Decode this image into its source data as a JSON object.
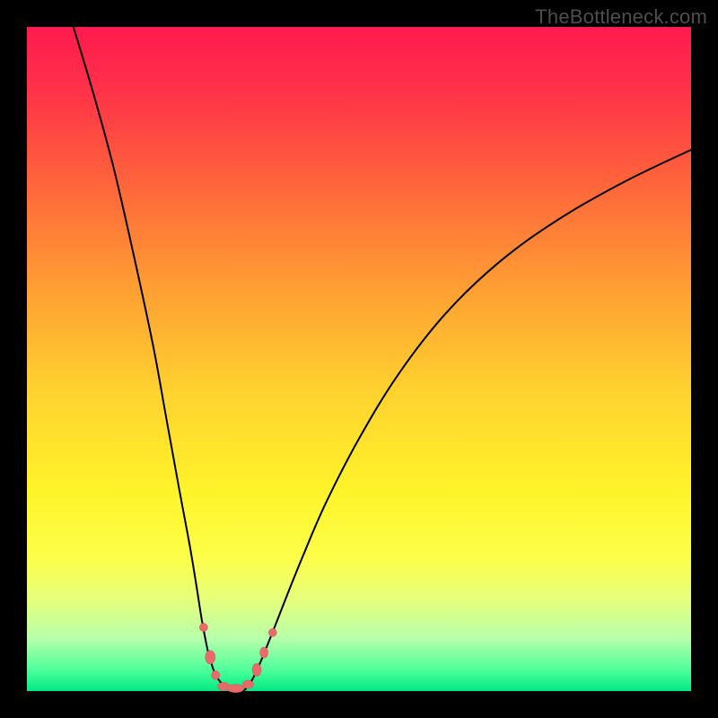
{
  "watermark": "TheBottleneck.com",
  "colors": {
    "frame": "#000000",
    "watermark": "#4e4e4e",
    "curve": "#000000",
    "marker_fill": "#e86a6a",
    "marker_stroke": "#d85a5a",
    "gradient_stops": [
      {
        "offset": 0.0,
        "color": "#ff1a4f"
      },
      {
        "offset": 0.1,
        "color": "#ff3348"
      },
      {
        "offset": 0.25,
        "color": "#ff6a3a"
      },
      {
        "offset": 0.4,
        "color": "#ffa133"
      },
      {
        "offset": 0.55,
        "color": "#ffd22f"
      },
      {
        "offset": 0.7,
        "color": "#fff42a"
      },
      {
        "offset": 0.8,
        "color": "#fcff4a"
      },
      {
        "offset": 0.86,
        "color": "#e8ff7a"
      },
      {
        "offset": 0.92,
        "color": "#b8ffab"
      },
      {
        "offset": 0.97,
        "color": "#4aff9a"
      },
      {
        "offset": 1.0,
        "color": "#00e884"
      }
    ]
  },
  "chart_data": {
    "type": "line",
    "title": "",
    "xlabel": "",
    "ylabel": "",
    "xlim": [
      0,
      100
    ],
    "ylim": [
      0,
      100
    ],
    "series": [
      {
        "name": "left-branch",
        "x": [
          7,
          10,
          13,
          16,
          19,
          21,
          23,
          24.5,
          25.5,
          26.2,
          26.8,
          27.3,
          27.8,
          28.2,
          28.6,
          29.1,
          29.5,
          30.0
        ],
        "y": [
          100,
          90,
          79,
          66,
          52,
          41,
          30,
          22,
          16,
          11.5,
          8.2,
          5.8,
          4.1,
          2.9,
          2.1,
          1.4,
          0.9,
          0.4
        ]
      },
      {
        "name": "right-branch",
        "x": [
          33.0,
          33.8,
          34.7,
          35.8,
          37.2,
          39.0,
          41.5,
          45.0,
          50.0,
          56.0,
          63.0,
          71.0,
          80.0,
          90.0,
          100.0
        ],
        "y": [
          0.4,
          1.5,
          3.3,
          5.9,
          9.4,
          14.0,
          20.2,
          28.3,
          38.0,
          47.8,
          56.8,
          64.5,
          71.0,
          76.7,
          81.5
        ]
      },
      {
        "name": "flat-bottom",
        "x": [
          30.0,
          30.5,
          31.0,
          31.6,
          32.2,
          32.7,
          33.0
        ],
        "y": [
          0.4,
          0.15,
          0.05,
          0.02,
          0.05,
          0.15,
          0.4
        ]
      }
    ],
    "markers": [
      {
        "x": 26.6,
        "y": 9.6,
        "rx": 4.5,
        "ry": 4.5
      },
      {
        "x": 27.6,
        "y": 5.1,
        "rx": 5.5,
        "ry": 7.5
      },
      {
        "x": 28.4,
        "y": 2.4,
        "rx": 4.5,
        "ry": 5.0
      },
      {
        "x": 29.6,
        "y": 0.7,
        "rx": 6.5,
        "ry": 4.5
      },
      {
        "x": 31.4,
        "y": 0.4,
        "rx": 9.5,
        "ry": 4.5
      },
      {
        "x": 33.3,
        "y": 1.0,
        "rx": 6.0,
        "ry": 4.5
      },
      {
        "x": 34.6,
        "y": 3.2,
        "rx": 5.0,
        "ry": 7.0
      },
      {
        "x": 35.7,
        "y": 5.8,
        "rx": 4.5,
        "ry": 6.0
      },
      {
        "x": 37.0,
        "y": 8.8,
        "rx": 4.5,
        "ry": 4.5
      }
    ]
  }
}
